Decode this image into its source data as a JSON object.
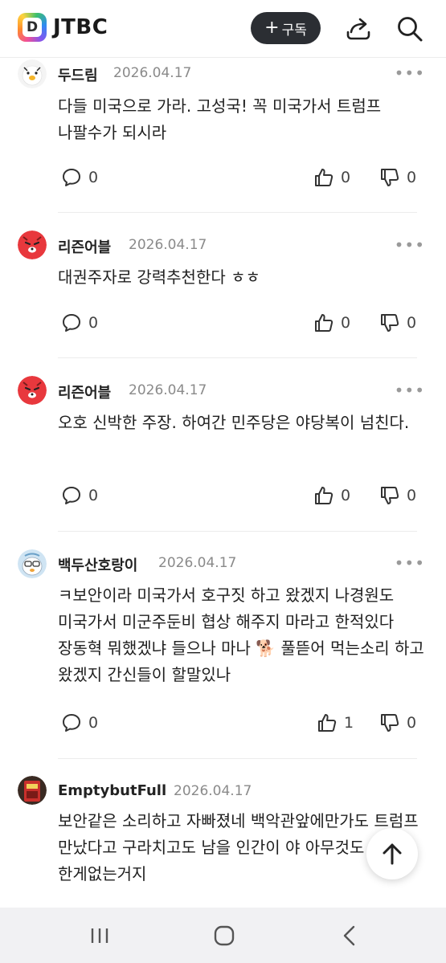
{
  "header": {
    "logo_mark": "D",
    "logo_text": "JTBC",
    "subscribe_label": "구독",
    "subscribe_icon": "plus-icon",
    "share_icon": "share-icon",
    "search_icon": "search-icon"
  },
  "comments": [
    {
      "author": "두드림",
      "date": "2026.04.17",
      "body": "다들 미국으로 가라. 고성국! 꼭 미국가서 트럼프 나팔수가 되시라",
      "replies": "0",
      "likes": "0",
      "dislikes": "0"
    },
    {
      "author": "리즌어블",
      "date": "2026.04.17",
      "body": "대권주자로 강력추천한다 ㅎㅎ",
      "replies": "0",
      "likes": "0",
      "dislikes": "0"
    },
    {
      "author": "리즌어블",
      "date": "2026.04.17",
      "body": "오호 신박한 주장. 하여간 민주당은 야당복이 넘친다.",
      "replies": "0",
      "likes": "0",
      "dislikes": "0"
    },
    {
      "author": "백두산호랑이",
      "date": "2026.04.17",
      "body": "ㅋ보안이라 미국가서 호구짓 하고 왔겠지 나경원도 미국가서 미군주둔비 협상 해주지 마라고 한적있다 장동혁 뭐했겠냐 들으나 마나 🐕 풀뜯어 먹는소리 하고 왔겠지 간신들이 할말있나",
      "replies": "0",
      "likes": "1",
      "dislikes": "0"
    },
    {
      "author": "EmptybutFull",
      "date": "2026.04.17",
      "body": "보안같은 소리하고 자빠졌네 백악관앞에만가도 트럼프 만났다고 구라치고도 남을 인간이 야 아무것도 한게없는거지"
    }
  ],
  "more_icon": "more-dots-icon",
  "reply_icon": "speech-bubble-icon",
  "like_icon": "thumbs-up-icon",
  "dislike_icon": "thumbs-down-icon",
  "scroll_top_icon": "arrow-up-icon",
  "navbar": {
    "recent_apps_icon": "recent-apps-icon",
    "home_icon": "home-icon",
    "back_icon": "back-icon"
  }
}
